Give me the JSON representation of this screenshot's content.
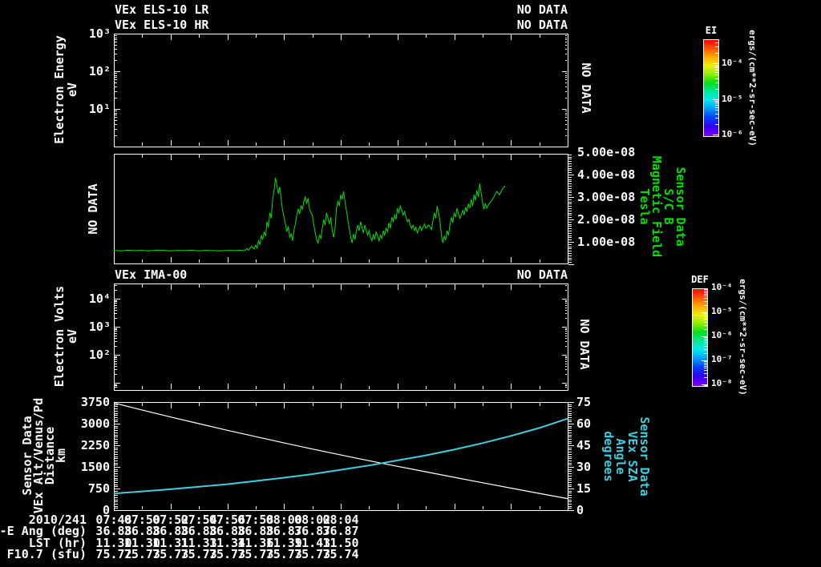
{
  "colors": {
    "background": "#000000",
    "axis": "#ffffff",
    "trace_green": "#00e000",
    "trace_white": "#ffffff",
    "trace_cyan": "#3fcfe0"
  },
  "panel1": {
    "title_lr": "VEx ELS-10 LR",
    "title_hr": "VEx ELS-10 HR",
    "no_data_lr": "NO DATA",
    "no_data_hr": "NO DATA",
    "overlay_right": "NO DATA",
    "ylabel": "Electron Energy",
    "yunit": "eV",
    "yticks": [
      "10³",
      "10²",
      "10¹"
    ]
  },
  "panel2": {
    "overlay_left": "NO DATA",
    "yticks_right": [
      "5.00e-08",
      "4.00e-08",
      "3.00e-08",
      "2.00e-08",
      "1.00e-08"
    ],
    "right_labels": [
      "Sensor Data",
      "S/C B",
      "Magnetic Field",
      "Tesla"
    ]
  },
  "panel3": {
    "title": "VEx IMA-00",
    "no_data": "NO DATA",
    "overlay_right": "NO DATA",
    "ylabel": "Electron Volts",
    "yunit": "eV",
    "yticks": [
      "10⁴",
      "10³",
      "10²"
    ]
  },
  "panel4": {
    "left_labels": [
      "Sensor Data",
      "VEx Alt/Venus/Pd",
      "Distance",
      "km"
    ],
    "yticks_left": [
      "3750",
      "3000",
      "2250",
      "1500",
      "750",
      "0"
    ],
    "yticks_right": [
      "75",
      "60",
      "45",
      "30",
      "15",
      "0"
    ],
    "right_labels": [
      "Sensor Data",
      "VEx SZA",
      "Angle",
      "degrees"
    ]
  },
  "colorbar_ei": {
    "title": "EI",
    "ticks": [
      "10⁻⁴",
      "10⁻⁵",
      "10⁻⁶"
    ],
    "unit": "ergs/(cm**2-sr-sec-eV)"
  },
  "colorbar_def": {
    "title": "DEF",
    "ticks": [
      "10⁻⁴",
      "10⁻⁵",
      "10⁻⁶",
      "10⁻⁷",
      "10⁻⁸"
    ],
    "unit": "ergs/(cm**2-sr-sec-eV)"
  },
  "xaxis": {
    "date": "2010/241",
    "times": [
      "07:48",
      "07:50",
      "07:52",
      "07:54",
      "07:56",
      "07:58",
      "08:00",
      "08:02",
      "08:04"
    ]
  },
  "rows": [
    {
      "label": "V-E Ang (deg)",
      "values": [
        "36.88",
        "36.88",
        "36.88",
        "36.88",
        "36.88",
        "36.88",
        "36.87",
        "36.87",
        "36.87"
      ]
    },
    {
      "label": "LST (hr)",
      "values": [
        "11.30",
        "11.30",
        "11.31",
        "11.33",
        "11.34",
        "11.36",
        "11.39",
        "11.43",
        "11.50"
      ]
    },
    {
      "label": "F10.7 (sfu)",
      "values": [
        "75.72",
        "75.73",
        "75.73",
        "75.73",
        "75.73",
        "75.73",
        "75.73",
        "75.73",
        "75.74"
      ]
    }
  ],
  "chart_data": [
    {
      "type": "heatmap",
      "title": "VEx ELS-10 LR / VEx ELS-10 HR",
      "status": "NO DATA",
      "ylabel": "Electron Energy (eV)",
      "yscale": "log",
      "yticks": [
        10,
        100,
        1000
      ],
      "x_range": [
        "07:48",
        "08:04"
      ],
      "colorbar": {
        "title": "EI",
        "unit": "ergs/(cm**2-sr-sec-eV)",
        "ticks": [
          "1e-4",
          "1e-5",
          "1e-6"
        ]
      }
    },
    {
      "type": "line",
      "name": "S/C B Magnetic Field",
      "ylabel": "Tesla",
      "ylim": [
        0,
        5e-08
      ],
      "x_unit": "minutes after 07:48",
      "value_unit": "1e-8 Tesla",
      "points": [
        [
          0,
          0.62
        ],
        [
          0.25,
          0.6
        ],
        [
          0.5,
          0.63
        ],
        [
          0.75,
          0.61
        ],
        [
          1,
          0.62
        ],
        [
          1.25,
          0.6
        ],
        [
          1.5,
          0.63
        ],
        [
          1.75,
          0.62
        ],
        [
          2,
          0.6
        ],
        [
          2.25,
          0.62
        ],
        [
          2.5,
          0.61
        ],
        [
          2.75,
          0.63
        ],
        [
          3,
          0.6
        ],
        [
          3.25,
          0.62
        ],
        [
          3.5,
          0.61
        ],
        [
          3.75,
          0.6
        ],
        [
          4,
          0.62
        ],
        [
          4.25,
          0.61
        ],
        [
          4.5,
          0.63
        ],
        [
          4.6,
          0.6
        ],
        [
          4.7,
          0.7
        ],
        [
          4.75,
          0.62
        ],
        [
          4.85,
          0.8
        ],
        [
          4.95,
          0.68
        ],
        [
          5,
          0.85
        ],
        [
          5.05,
          0.72
        ],
        [
          5.1,
          1.05
        ],
        [
          5.15,
          0.88
        ],
        [
          5.2,
          1.3
        ],
        [
          5.25,
          1.1
        ],
        [
          5.3,
          1.45
        ],
        [
          5.35,
          1.25
        ],
        [
          5.4,
          1.9
        ],
        [
          5.45,
          1.65
        ],
        [
          5.5,
          2.3
        ],
        [
          5.55,
          2.05
        ],
        [
          5.6,
          2.9
        ],
        [
          5.65,
          3.3
        ],
        [
          5.7,
          3.86
        ],
        [
          5.75,
          3.5
        ],
        [
          5.8,
          3.15
        ],
        [
          5.85,
          3.45
        ],
        [
          5.9,
          2.9
        ],
        [
          5.95,
          2.4
        ],
        [
          6,
          2.1
        ],
        [
          6.05,
          1.8
        ],
        [
          6.1,
          1.45
        ],
        [
          6.15,
          1.7
        ],
        [
          6.2,
          1.2
        ],
        [
          6.25,
          1.35
        ],
        [
          6.3,
          1.05
        ],
        [
          6.35,
          1.5
        ],
        [
          6.4,
          1.8
        ],
        [
          6.45,
          2.2
        ],
        [
          6.5,
          2.45
        ],
        [
          6.55,
          2.25
        ],
        [
          6.6,
          2.6
        ],
        [
          6.65,
          2.45
        ],
        [
          6.7,
          2.8
        ],
        [
          6.75,
          3
        ],
        [
          6.8,
          2.7
        ],
        [
          6.85,
          2.95
        ],
        [
          6.9,
          2.45
        ],
        [
          6.95,
          2.3
        ],
        [
          7,
          2.2
        ],
        [
          7.05,
          1.75
        ],
        [
          7.1,
          1.4
        ],
        [
          7.15,
          1.1
        ],
        [
          7.2,
          0.95
        ],
        [
          7.25,
          1.3
        ],
        [
          7.3,
          1.15
        ],
        [
          7.35,
          1.6
        ],
        [
          7.4,
          2
        ],
        [
          7.45,
          1.75
        ],
        [
          7.5,
          2.3
        ],
        [
          7.55,
          2.05
        ],
        [
          7.6,
          1.8
        ],
        [
          7.65,
          2.1
        ],
        [
          7.7,
          1.5
        ],
        [
          7.75,
          1.2
        ],
        [
          7.8,
          1.6
        ],
        [
          7.85,
          2.5
        ],
        [
          7.9,
          2.8
        ],
        [
          7.95,
          2.6
        ],
        [
          8,
          3.1
        ],
        [
          8.05,
          2.9
        ],
        [
          8.1,
          3.25
        ],
        [
          8.15,
          2.8
        ],
        [
          8.2,
          2.4
        ],
        [
          8.25,
          2
        ],
        [
          8.3,
          1.6
        ],
        [
          8.35,
          1.2
        ],
        [
          8.4,
          0.95
        ],
        [
          8.45,
          1.35
        ],
        [
          8.5,
          1.1
        ],
        [
          8.55,
          1.5
        ],
        [
          8.6,
          1.75
        ],
        [
          8.65,
          1.5
        ],
        [
          8.7,
          1.9
        ],
        [
          8.75,
          1.65
        ],
        [
          8.8,
          1.4
        ],
        [
          8.85,
          1.75
        ],
        [
          8.9,
          1.5
        ],
        [
          8.95,
          1.3
        ],
        [
          9,
          1.5
        ],
        [
          9.05,
          1.2
        ],
        [
          9.1,
          1.05
        ],
        [
          9.15,
          1.35
        ],
        [
          9.2,
          1.1
        ],
        [
          9.25,
          1.45
        ],
        [
          9.3,
          1.25
        ],
        [
          9.35,
          1.05
        ],
        [
          9.4,
          1.3
        ],
        [
          9.45,
          1.15
        ],
        [
          9.5,
          1.5
        ],
        [
          9.55,
          1.3
        ],
        [
          9.6,
          1.6
        ],
        [
          9.65,
          1.45
        ],
        [
          9.7,
          1.85
        ],
        [
          9.75,
          1.6
        ],
        [
          9.8,
          2.1
        ],
        [
          9.85,
          1.9
        ],
        [
          9.9,
          2.2
        ],
        [
          9.95,
          2
        ],
        [
          10,
          2.5
        ],
        [
          10.05,
          2.3
        ],
        [
          10.1,
          2.6
        ],
        [
          10.15,
          2.4
        ],
        [
          10.2,
          2.2
        ],
        [
          10.25,
          2.35
        ],
        [
          10.3,
          2.1
        ],
        [
          10.35,
          1.9
        ],
        [
          10.4,
          2
        ],
        [
          10.45,
          1.75
        ],
        [
          10.5,
          1.6
        ],
        [
          10.55,
          1.75
        ],
        [
          10.6,
          1.5
        ],
        [
          10.65,
          1.65
        ],
        [
          10.7,
          1.4
        ],
        [
          10.75,
          1.55
        ],
        [
          10.8,
          1.7
        ],
        [
          10.85,
          1.5
        ],
        [
          10.9,
          1.65
        ],
        [
          10.95,
          1.8
        ],
        [
          11,
          1.6
        ],
        [
          11.1,
          1.75
        ],
        [
          11.2,
          1.55
        ],
        [
          11.3,
          2.3
        ],
        [
          11.35,
          2.05
        ],
        [
          11.4,
          2.6
        ],
        [
          11.45,
          2.3
        ],
        [
          11.5,
          1.9
        ],
        [
          11.55,
          1.3
        ],
        [
          11.6,
          0.95
        ],
        [
          11.65,
          1.25
        ],
        [
          11.7,
          1.1
        ],
        [
          11.75,
          1.5
        ],
        [
          11.8,
          1.3
        ],
        [
          11.85,
          1.75
        ],
        [
          11.9,
          2.1
        ],
        [
          11.95,
          1.85
        ],
        [
          12,
          2.3
        ],
        [
          12.05,
          2.1
        ],
        [
          12.1,
          2.5
        ],
        [
          12.15,
          2.25
        ],
        [
          12.2,
          2.05
        ],
        [
          12.25,
          2.2
        ],
        [
          12.3,
          2.4
        ],
        [
          12.35,
          2.2
        ],
        [
          12.4,
          2.55
        ],
        [
          12.45,
          2.35
        ],
        [
          12.5,
          2.7
        ],
        [
          12.55,
          2.5
        ],
        [
          12.6,
          2.9
        ],
        [
          12.65,
          2.6
        ],
        [
          12.7,
          3.1
        ],
        [
          12.75,
          2.85
        ],
        [
          12.8,
          3.3
        ],
        [
          12.85,
          3
        ],
        [
          12.9,
          3.6
        ],
        [
          12.95,
          3.2
        ],
        [
          13,
          2.75
        ],
        [
          13.05,
          2.45
        ],
        [
          13.1,
          2.7
        ],
        [
          13.15,
          2.5
        ],
        [
          13.2,
          2.65
        ],
        [
          13.3,
          2.8
        ],
        [
          13.4,
          3
        ],
        [
          13.5,
          3.25
        ],
        [
          13.6,
          3.1
        ],
        [
          13.7,
          3.35
        ],
        [
          13.8,
          3.5
        ]
      ]
    },
    {
      "type": "heatmap",
      "title": "VEx IMA-00",
      "status": "NO DATA",
      "ylabel": "Electron Volts (eV)",
      "yscale": "log",
      "yticks": [
        100,
        1000,
        10000
      ],
      "colorbar": {
        "title": "DEF",
        "unit": "ergs/(cm**2-sr-sec-eV)",
        "ticks": [
          "1e-4",
          "1e-5",
          "1e-6",
          "1e-7",
          "1e-8"
        ]
      }
    },
    {
      "type": "line",
      "x_unit": "minutes after 07:48",
      "series": [
        {
          "name": "VEx Alt/Venus/Pd Distance",
          "unit": "km",
          "axis": "left",
          "ylim": [
            0,
            3750
          ],
          "color": "#ffffff",
          "points": [
            [
              0,
              3720
            ],
            [
              1,
              3470
            ],
            [
              2,
              3230
            ],
            [
              3,
              3000
            ],
            [
              4,
              2770
            ],
            [
              5,
              2550
            ],
            [
              6,
              2330
            ],
            [
              7,
              2120
            ],
            [
              8,
              1915
            ],
            [
              9,
              1715
            ],
            [
              10,
              1520
            ],
            [
              11,
              1330
            ],
            [
              12,
              1140
            ],
            [
              13,
              950
            ],
            [
              14,
              765
            ],
            [
              15,
              580
            ],
            [
              16,
              400
            ]
          ]
        },
        {
          "name": "VEx SZA Angle",
          "unit": "degrees",
          "axis": "right",
          "ylim": [
            0,
            75
          ],
          "color": "#3fcfe0",
          "points": [
            [
              0,
              11.5
            ],
            [
              1,
              13
            ],
            [
              2,
              14.5
            ],
            [
              3,
              16.2
            ],
            [
              4,
              18
            ],
            [
              5,
              20.2
            ],
            [
              6,
              22.5
            ],
            [
              7,
              25
            ],
            [
              8,
              28
            ],
            [
              9,
              31
            ],
            [
              10,
              34.5
            ],
            [
              11,
              38
            ],
            [
              12,
              42
            ],
            [
              13,
              46.5
            ],
            [
              14,
              51.5
            ],
            [
              15,
              57
            ],
            [
              16,
              63.5
            ]
          ]
        }
      ]
    }
  ]
}
